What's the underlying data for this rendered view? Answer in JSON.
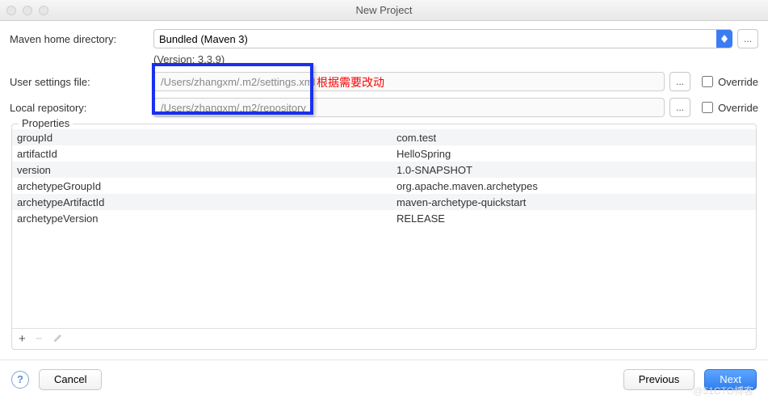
{
  "window": {
    "title": "New Project"
  },
  "form": {
    "maven_home_label": "Maven home directory:",
    "maven_home_value": "Bundled (Maven 3)",
    "version_text": "(Version: 3.3.9)",
    "user_settings_label": "User settings file:",
    "user_settings_value": "/Users/zhangxm/.m2/settings.xml",
    "local_repo_label": "Local repository:",
    "local_repo_value": "/Users/zhangxm/.m2/repository",
    "override_label": "Override",
    "browse_label": "..."
  },
  "annotation": "根据需要改动",
  "properties": {
    "legend": "Properties",
    "rows": [
      {
        "key": "groupId",
        "value": "com.test"
      },
      {
        "key": "artifactId",
        "value": "HelloSpring"
      },
      {
        "key": "version",
        "value": "1.0-SNAPSHOT"
      },
      {
        "key": "archetypeGroupId",
        "value": "org.apache.maven.archetypes"
      },
      {
        "key": "archetypeArtifactId",
        "value": "maven-archetype-quickstart"
      },
      {
        "key": "archetypeVersion",
        "value": "RELEASE"
      }
    ]
  },
  "footer": {
    "cancel": "Cancel",
    "previous": "Previous",
    "next": "Next",
    "help": "?"
  },
  "watermark": "@51CTO博客"
}
